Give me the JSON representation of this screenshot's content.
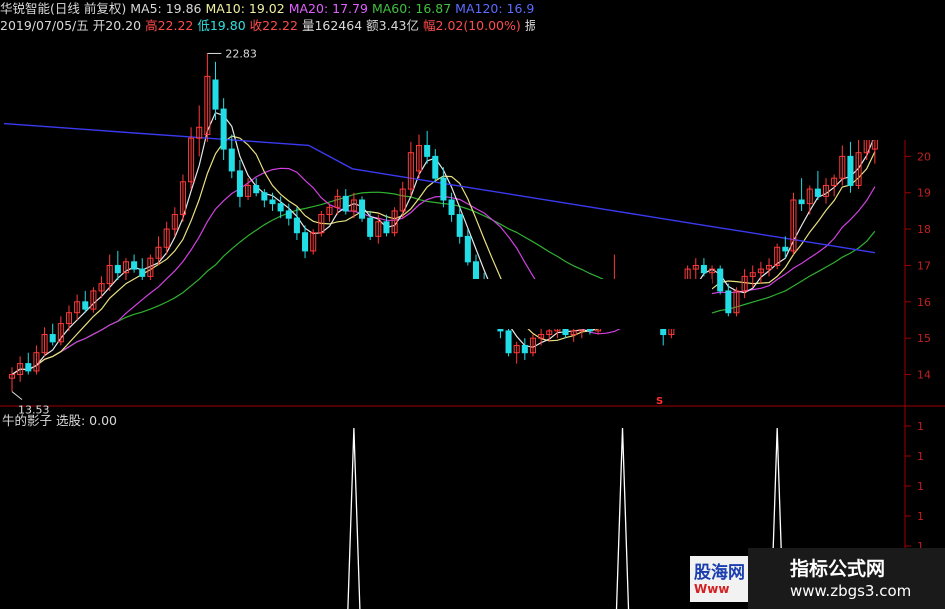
{
  "header": {
    "line1": [
      {
        "text": "华锐智能(日线 前复权)",
        "cls": "w"
      },
      {
        "text": "MA5: 19.86",
        "cls": "w"
      },
      {
        "text": "MA10: 19.02",
        "cls": "y"
      },
      {
        "text": "MA20: 17.79",
        "cls": "m"
      },
      {
        "text": "MA60: 16.87",
        "cls": "g"
      },
      {
        "text": "MA120: 16.9",
        "cls": "b"
      }
    ],
    "line2": [
      {
        "text": "2019/07/05/五",
        "cls": "w"
      },
      {
        "text": "开20.20",
        "cls": "w"
      },
      {
        "text": "高22.22",
        "cls": "r"
      },
      {
        "text": "低19.80",
        "cls": "c"
      },
      {
        "text": "收22.22",
        "cls": "r"
      },
      {
        "text": "量162464",
        "cls": "w"
      },
      {
        "text": "额3.43亿",
        "cls": "w"
      },
      {
        "text": "幅2.02(10.00%)",
        "cls": "r"
      },
      {
        "text": "振",
        "cls": "w"
      }
    ]
  },
  "indicator_title": "牛的影子  选股: 0.00",
  "price_axis_labels": [
    "20",
    "19",
    "18",
    "17",
    "16",
    "15",
    "14"
  ],
  "indicator_axis_labels": [
    "1",
    "1",
    "1",
    "1",
    "1",
    "1",
    "1"
  ],
  "annotations": {
    "high": "22.83",
    "low": "13.53",
    "marker": "S"
  },
  "colors": {
    "up": "#ff3a3a",
    "down": "#22dde6",
    "ma5": "#e8e8e8",
    "ma10": "#e8e080",
    "ma20": "#d040e0",
    "ma60": "#30b030",
    "ma120": "#3a3af0",
    "axis": "#a00000",
    "signal": "#ffffff"
  },
  "watermark": {
    "title": "指标公式网",
    "url": "www.zbgs3.com",
    "logo_top": "股海网",
    "logo_bot": "Www"
  },
  "chart_data": [
    {
      "type": "candlestick",
      "title": "华锐智能(日线 前复权)",
      "ylim": [
        13.3,
        23.2
      ],
      "y_ticks": [
        20,
        19,
        18,
        17,
        16,
        15,
        14
      ],
      "candles": [
        {
          "o": 13.9,
          "h": 14.2,
          "l": 13.53,
          "c": 14.0
        },
        {
          "o": 14.0,
          "h": 14.5,
          "l": 13.8,
          "c": 14.3
        },
        {
          "o": 14.3,
          "h": 14.6,
          "l": 14.0,
          "c": 14.1
        },
        {
          "o": 14.1,
          "h": 14.8,
          "l": 14.0,
          "c": 14.6
        },
        {
          "o": 14.6,
          "h": 15.3,
          "l": 14.5,
          "c": 15.1
        },
        {
          "o": 15.1,
          "h": 15.4,
          "l": 14.8,
          "c": 14.9
        },
        {
          "o": 14.9,
          "h": 15.6,
          "l": 14.8,
          "c": 15.4
        },
        {
          "o": 15.4,
          "h": 15.9,
          "l": 15.2,
          "c": 15.7
        },
        {
          "o": 15.7,
          "h": 16.2,
          "l": 15.5,
          "c": 16.0
        },
        {
          "o": 16.0,
          "h": 16.3,
          "l": 15.7,
          "c": 15.8
        },
        {
          "o": 15.8,
          "h": 16.4,
          "l": 15.7,
          "c": 16.3
        },
        {
          "o": 16.3,
          "h": 16.7,
          "l": 16.1,
          "c": 16.5
        },
        {
          "o": 16.5,
          "h": 17.3,
          "l": 16.3,
          "c": 17.0
        },
        {
          "o": 17.0,
          "h": 17.4,
          "l": 16.6,
          "c": 16.8
        },
        {
          "o": 16.8,
          "h": 17.2,
          "l": 16.6,
          "c": 17.1
        },
        {
          "o": 17.1,
          "h": 17.3,
          "l": 16.8,
          "c": 16.9
        },
        {
          "o": 16.9,
          "h": 17.2,
          "l": 16.6,
          "c": 16.7
        },
        {
          "o": 16.7,
          "h": 17.3,
          "l": 16.6,
          "c": 17.2
        },
        {
          "o": 17.2,
          "h": 17.8,
          "l": 17.0,
          "c": 17.5
        },
        {
          "o": 17.5,
          "h": 18.2,
          "l": 17.3,
          "c": 18.0
        },
        {
          "o": 18.0,
          "h": 18.6,
          "l": 17.8,
          "c": 18.4
        },
        {
          "o": 18.4,
          "h": 19.5,
          "l": 18.2,
          "c": 19.3
        },
        {
          "o": 19.3,
          "h": 20.8,
          "l": 19.1,
          "c": 20.5
        },
        {
          "o": 20.5,
          "h": 21.4,
          "l": 20.0,
          "c": 20.8
        },
        {
          "o": 20.6,
          "h": 22.83,
          "l": 20.4,
          "c": 22.2
        },
        {
          "o": 22.1,
          "h": 22.6,
          "l": 21.0,
          "c": 21.3
        },
        {
          "o": 21.3,
          "h": 21.6,
          "l": 19.9,
          "c": 20.2
        },
        {
          "o": 20.2,
          "h": 20.6,
          "l": 19.4,
          "c": 19.6
        },
        {
          "o": 19.6,
          "h": 19.9,
          "l": 18.6,
          "c": 18.9
        },
        {
          "o": 18.9,
          "h": 19.4,
          "l": 18.8,
          "c": 19.2
        },
        {
          "o": 19.2,
          "h": 19.4,
          "l": 18.9,
          "c": 19.0
        },
        {
          "o": 19.0,
          "h": 19.1,
          "l": 18.6,
          "c": 18.8
        },
        {
          "o": 18.8,
          "h": 19.0,
          "l": 18.5,
          "c": 18.7
        },
        {
          "o": 18.7,
          "h": 18.9,
          "l": 18.3,
          "c": 18.5
        },
        {
          "o": 18.5,
          "h": 18.7,
          "l": 18.1,
          "c": 18.3
        },
        {
          "o": 18.3,
          "h": 18.6,
          "l": 17.7,
          "c": 17.9
        },
        {
          "o": 17.9,
          "h": 18.1,
          "l": 17.2,
          "c": 17.4
        },
        {
          "o": 17.4,
          "h": 18.0,
          "l": 17.3,
          "c": 17.9
        },
        {
          "o": 17.9,
          "h": 18.5,
          "l": 17.8,
          "c": 18.4
        },
        {
          "o": 18.4,
          "h": 18.7,
          "l": 18.2,
          "c": 18.6
        },
        {
          "o": 18.6,
          "h": 19.1,
          "l": 18.4,
          "c": 18.9
        },
        {
          "o": 18.9,
          "h": 19.1,
          "l": 18.4,
          "c": 18.5
        },
        {
          "o": 18.5,
          "h": 19.0,
          "l": 18.3,
          "c": 18.8
        },
        {
          "o": 18.8,
          "h": 18.9,
          "l": 18.2,
          "c": 18.3
        },
        {
          "o": 18.3,
          "h": 18.5,
          "l": 17.7,
          "c": 17.8
        },
        {
          "o": 17.8,
          "h": 18.4,
          "l": 17.6,
          "c": 18.2
        },
        {
          "o": 18.2,
          "h": 18.4,
          "l": 17.8,
          "c": 17.9
        },
        {
          "o": 17.9,
          "h": 18.6,
          "l": 17.8,
          "c": 18.5
        },
        {
          "o": 18.5,
          "h": 19.3,
          "l": 18.3,
          "c": 19.1
        },
        {
          "o": 19.1,
          "h": 20.4,
          "l": 18.9,
          "c": 20.1
        },
        {
          "o": 19.6,
          "h": 20.6,
          "l": 19.4,
          "c": 20.3
        },
        {
          "o": 20.3,
          "h": 20.7,
          "l": 19.8,
          "c": 20.0
        },
        {
          "o": 20.0,
          "h": 20.2,
          "l": 19.3,
          "c": 19.4
        },
        {
          "o": 19.4,
          "h": 19.7,
          "l": 18.6,
          "c": 18.8
        },
        {
          "o": 18.8,
          "h": 19.0,
          "l": 18.2,
          "c": 18.4
        },
        {
          "o": 18.4,
          "h": 18.6,
          "l": 17.6,
          "c": 17.8
        },
        {
          "o": 17.8,
          "h": 18.0,
          "l": 17.0,
          "c": 17.1
        },
        {
          "o": 17.1,
          "h": 17.3,
          "l": 16.3,
          "c": 16.5
        },
        {
          "o": 16.5,
          "h": 16.8,
          "l": 15.9,
          "c": 16.1
        },
        {
          "o": 16.1,
          "h": 16.4,
          "l": 15.5,
          "c": 15.6
        },
        {
          "o": 15.6,
          "h": 15.9,
          "l": 15.0,
          "c": 15.2
        },
        {
          "o": 15.2,
          "h": 15.4,
          "l": 14.5,
          "c": 14.6
        },
        {
          "o": 14.6,
          "h": 14.9,
          "l": 14.3,
          "c": 14.8
        },
        {
          "o": 14.8,
          "h": 15.0,
          "l": 14.4,
          "c": 14.6
        },
        {
          "o": 14.6,
          "h": 15.1,
          "l": 14.5,
          "c": 15.0
        },
        {
          "o": 15.0,
          "h": 15.3,
          "l": 14.8,
          "c": 15.1
        },
        {
          "o": 15.1,
          "h": 15.3,
          "l": 14.9,
          "c": 15.2
        },
        {
          "o": 15.2,
          "h": 15.4,
          "l": 15.0,
          "c": 15.3
        },
        {
          "o": 15.3,
          "h": 15.4,
          "l": 15.0,
          "c": 15.1
        },
        {
          "o": 15.1,
          "h": 15.3,
          "l": 14.9,
          "c": 15.2
        },
        {
          "o": 15.2,
          "h": 15.4,
          "l": 15.0,
          "c": 15.3
        },
        {
          "o": 15.3,
          "h": 15.5,
          "l": 15.1,
          "c": 15.2
        },
        {
          "o": 15.2,
          "h": 15.6,
          "l": 15.1,
          "c": 15.5
        },
        {
          "o": 15.5,
          "h": 16.0,
          "l": 15.3,
          "c": 15.8
        },
        {
          "o": 15.8,
          "h": 17.3,
          "l": 15.7,
          "c": 15.9
        },
        {
          "o": 15.9,
          "h": 16.3,
          "l": 15.7,
          "c": 16.1
        },
        {
          "o": 16.1,
          "h": 16.4,
          "l": 15.9,
          "c": 16.2
        },
        {
          "o": 16.2,
          "h": 16.5,
          "l": 15.9,
          "c": 16.3
        },
        {
          "o": 16.3,
          "h": 16.6,
          "l": 16.0,
          "c": 16.4
        },
        {
          "o": 16.4,
          "h": 16.6,
          "l": 15.9,
          "c": 16.0
        },
        {
          "o": 16.0,
          "h": 16.3,
          "l": 14.8,
          "c": 15.1
        },
        {
          "o": 15.1,
          "h": 15.5,
          "l": 15.0,
          "c": 15.4
        },
        {
          "o": 15.4,
          "h": 16.6,
          "l": 15.3,
          "c": 16.4
        },
        {
          "o": 16.4,
          "h": 17.0,
          "l": 16.2,
          "c": 16.9
        },
        {
          "o": 16.9,
          "h": 17.2,
          "l": 16.6,
          "c": 17.0
        },
        {
          "o": 17.0,
          "h": 17.2,
          "l": 16.7,
          "c": 16.8
        },
        {
          "o": 16.8,
          "h": 17.0,
          "l": 16.5,
          "c": 16.9
        },
        {
          "o": 16.9,
          "h": 17.0,
          "l": 16.2,
          "c": 16.3
        },
        {
          "o": 16.3,
          "h": 16.5,
          "l": 15.6,
          "c": 15.7
        },
        {
          "o": 15.7,
          "h": 16.4,
          "l": 15.6,
          "c": 16.3
        },
        {
          "o": 16.3,
          "h": 16.9,
          "l": 16.1,
          "c": 16.7
        },
        {
          "o": 16.7,
          "h": 17.0,
          "l": 16.4,
          "c": 16.8
        },
        {
          "o": 16.8,
          "h": 17.1,
          "l": 16.5,
          "c": 16.9
        },
        {
          "o": 16.9,
          "h": 17.2,
          "l": 16.7,
          "c": 17.0
        },
        {
          "o": 17.0,
          "h": 17.6,
          "l": 16.9,
          "c": 17.5
        },
        {
          "o": 17.5,
          "h": 17.8,
          "l": 17.2,
          "c": 17.4
        },
        {
          "o": 17.4,
          "h": 19.0,
          "l": 17.3,
          "c": 18.8
        },
        {
          "o": 18.8,
          "h": 19.4,
          "l": 18.5,
          "c": 18.7
        },
        {
          "o": 18.7,
          "h": 19.2,
          "l": 18.4,
          "c": 19.1
        },
        {
          "o": 19.1,
          "h": 19.6,
          "l": 18.8,
          "c": 18.9
        },
        {
          "o": 18.9,
          "h": 19.4,
          "l": 18.7,
          "c": 19.2
        },
        {
          "o": 19.2,
          "h": 19.5,
          "l": 18.9,
          "c": 19.4
        },
        {
          "o": 19.4,
          "h": 20.3,
          "l": 19.2,
          "c": 20.0
        },
        {
          "o": 20.0,
          "h": 20.4,
          "l": 19.0,
          "c": 19.2
        },
        {
          "o": 19.2,
          "h": 20.5,
          "l": 19.1,
          "c": 20.1
        },
        {
          "o": 20.1,
          "h": 21.0,
          "l": 19.9,
          "c": 20.8
        },
        {
          "o": 20.2,
          "h": 22.22,
          "l": 19.8,
          "c": 22.22
        }
      ],
      "ma120": [
        16.9,
        16.95,
        17.0,
        17.05,
        17.1,
        17.15,
        17.2,
        17.25,
        17.3,
        17.35,
        17.45,
        17.55,
        17.65,
        17.7,
        17.8
      ]
    },
    {
      "type": "line",
      "title": "牛的影子  选股: 0.00",
      "ylim": [
        0,
        1
      ],
      "signals": [
        42,
        75,
        94
      ],
      "n": 122
    }
  ]
}
